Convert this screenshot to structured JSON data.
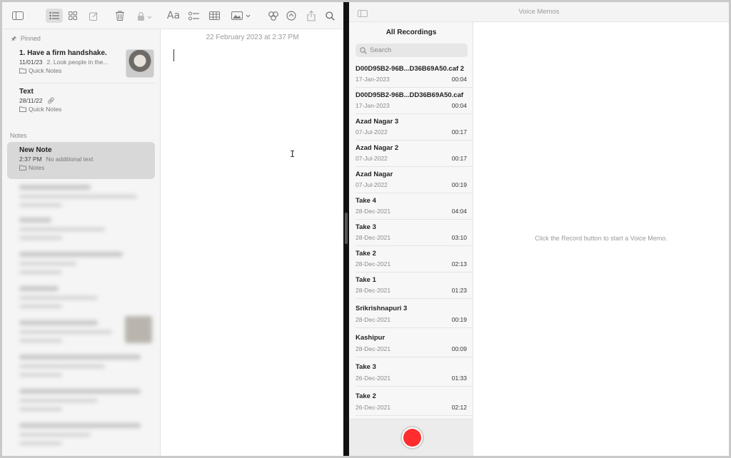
{
  "notes": {
    "pinned_label": "Pinned",
    "notes_label": "Notes",
    "pinned": [
      {
        "title": "1. Have a firm handshake.",
        "date": "11/01/23",
        "snippet": "2. Look people in the...",
        "folder": "Quick Notes"
      },
      {
        "title": "Text",
        "date": "28/11/22",
        "snippet": "",
        "folder": "Quick Notes"
      }
    ],
    "selected_note": {
      "title": "New Note",
      "date": "2:37 PM",
      "snippet": "No additional text",
      "folder": "Notes"
    },
    "editor": {
      "date": "22 February 2023 at 2:37 PM"
    },
    "toolbar": {
      "format_label": "Aa"
    }
  },
  "voice_memos": {
    "window_title": "Voice Memos",
    "heading": "All Recordings",
    "search_placeholder": "Search",
    "empty_hint": "Click the Record button to start a Voice Memo.",
    "recordings": [
      {
        "name": "D00D95B2-96B...D36B69A50.caf 2",
        "date": "17-Jan-2023",
        "duration": "00:04"
      },
      {
        "name": "D00D95B2-96B...DD36B69A50.caf",
        "date": "17-Jan-2023",
        "duration": "00:04"
      },
      {
        "name": "Azad Nagar 3",
        "date": "07-Jul-2022",
        "duration": "00:17"
      },
      {
        "name": "Azad Nagar 2",
        "date": "07-Jul-2022",
        "duration": "00:17"
      },
      {
        "name": "Azad Nagar",
        "date": "07-Jul-2022",
        "duration": "00:19"
      },
      {
        "name": "Take 4",
        "date": "28-Dec-2021",
        "duration": "04:04"
      },
      {
        "name": "Take 3",
        "date": "28-Dec-2021",
        "duration": "03:10"
      },
      {
        "name": "Take 2",
        "date": "28-Dec-2021",
        "duration": "02:13"
      },
      {
        "name": "Take 1",
        "date": "28-Dec-2021",
        "duration": "01:23"
      },
      {
        "name": "Srikrishnapuri 3",
        "date": "28-Dec-2021",
        "duration": "00:19"
      },
      {
        "name": "Kashipur",
        "date": "28-Dec-2021",
        "duration": "00:09"
      },
      {
        "name": "Take 3",
        "date": "26-Dec-2021",
        "duration": "01:33"
      },
      {
        "name": "Take 2",
        "date": "26-Dec-2021",
        "duration": "02:12"
      }
    ],
    "record_color": "#ff2d2d"
  }
}
